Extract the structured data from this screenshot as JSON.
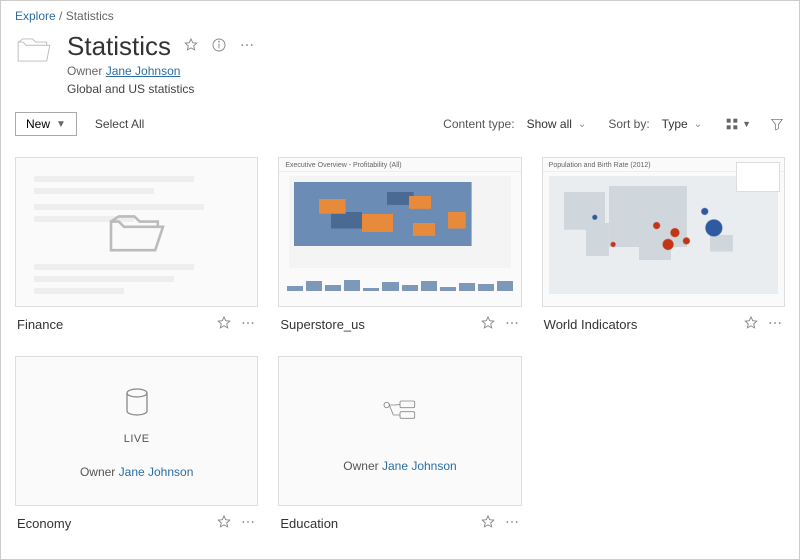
{
  "breadcrumb": {
    "root": "Explore",
    "sep": "/",
    "current": "Statistics"
  },
  "header": {
    "title": "Statistics",
    "owner_label": "Owner",
    "owner_name": "Jane Johnson",
    "description": "Global and US statistics"
  },
  "toolbar": {
    "new_label": "New",
    "select_all": "Select All",
    "content_type_label": "Content type:",
    "content_type_value": "Show all",
    "sort_label": "Sort by:",
    "sort_value": "Type"
  },
  "cards": [
    {
      "type": "folder",
      "title": "Finance"
    },
    {
      "type": "workbook",
      "title": "Superstore_us",
      "viz": "us",
      "viz_title": "Executive Overview - Profitability (All)"
    },
    {
      "type": "workbook",
      "title": "World Indicators",
      "viz": "world",
      "viz_title": "Population and Birth Rate (2012)"
    },
    {
      "type": "datasource",
      "title": "Economy",
      "badge": "LIVE",
      "owner_label": "Owner",
      "owner_name": "Jane Johnson",
      "glyph": "cylinder"
    },
    {
      "type": "datasource",
      "title": "Education",
      "badge": "",
      "owner_label": "Owner",
      "owner_name": "Jane Johnson",
      "glyph": "flow"
    }
  ]
}
